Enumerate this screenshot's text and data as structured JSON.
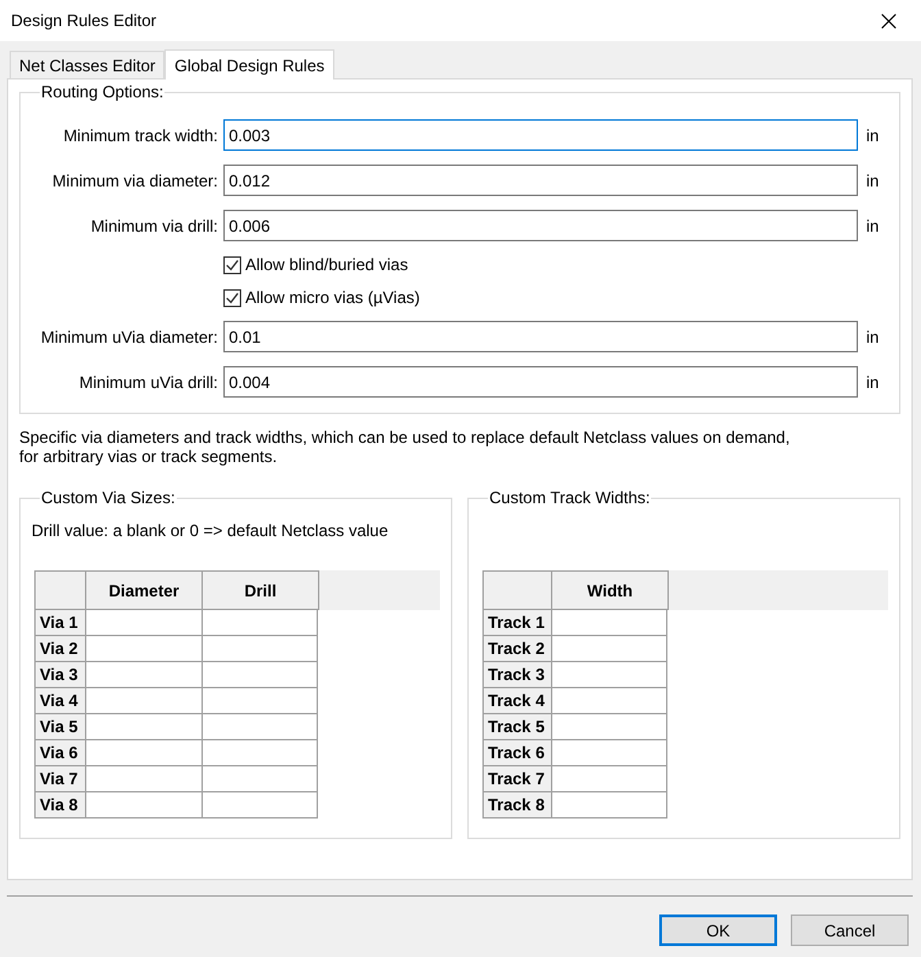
{
  "window": {
    "title": "Design Rules Editor"
  },
  "tabs": [
    {
      "label": "Net Classes Editor",
      "selected": false
    },
    {
      "label": "Global Design Rules",
      "selected": true
    }
  ],
  "routing": {
    "title": "Routing Options:",
    "items": [
      {
        "kind": "field",
        "label": "Minimum track width:",
        "value": "0.003",
        "unit": "in",
        "focused": true
      },
      {
        "kind": "field",
        "label": "Minimum via diameter:",
        "value": "0.012",
        "unit": "in",
        "focused": false
      },
      {
        "kind": "field",
        "label": "Minimum via drill:",
        "value": "0.006",
        "unit": "in",
        "focused": false
      },
      {
        "kind": "checkbox",
        "label": "Allow blind/buried vias",
        "checked": true
      },
      {
        "kind": "checkbox",
        "label": "Allow micro vias (µVias)",
        "checked": true
      },
      {
        "kind": "field",
        "label": "Minimum uVia diameter:",
        "value": "0.01",
        "unit": "in",
        "focused": false
      },
      {
        "kind": "field",
        "label": "Minimum uVia drill:",
        "value": "0.004",
        "unit": "in",
        "focused": false
      }
    ]
  },
  "description_lines": [
    "Specific via diameters and track widths, which can be used to replace default Netclass values on demand,",
    "for arbitrary vias or track segments."
  ],
  "via_sizes": {
    "title": "Custom Via Sizes:",
    "note": "Drill value: a blank or 0 => default Netclass value",
    "columns": [
      "Diameter",
      "Drill"
    ],
    "rows": [
      "Via 1",
      "Via 2",
      "Via 3",
      "Via 4",
      "Via 5",
      "Via 6",
      "Via 7",
      "Via 8"
    ]
  },
  "track_widths": {
    "title": "Custom Track Widths:",
    "columns": [
      "Width"
    ],
    "rows": [
      "Track 1",
      "Track 2",
      "Track 3",
      "Track 4",
      "Track 5",
      "Track 6",
      "Track 7",
      "Track 8"
    ]
  },
  "buttons": [
    {
      "label": "OK",
      "default": true
    },
    {
      "label": "Cancel",
      "default": false
    }
  ]
}
